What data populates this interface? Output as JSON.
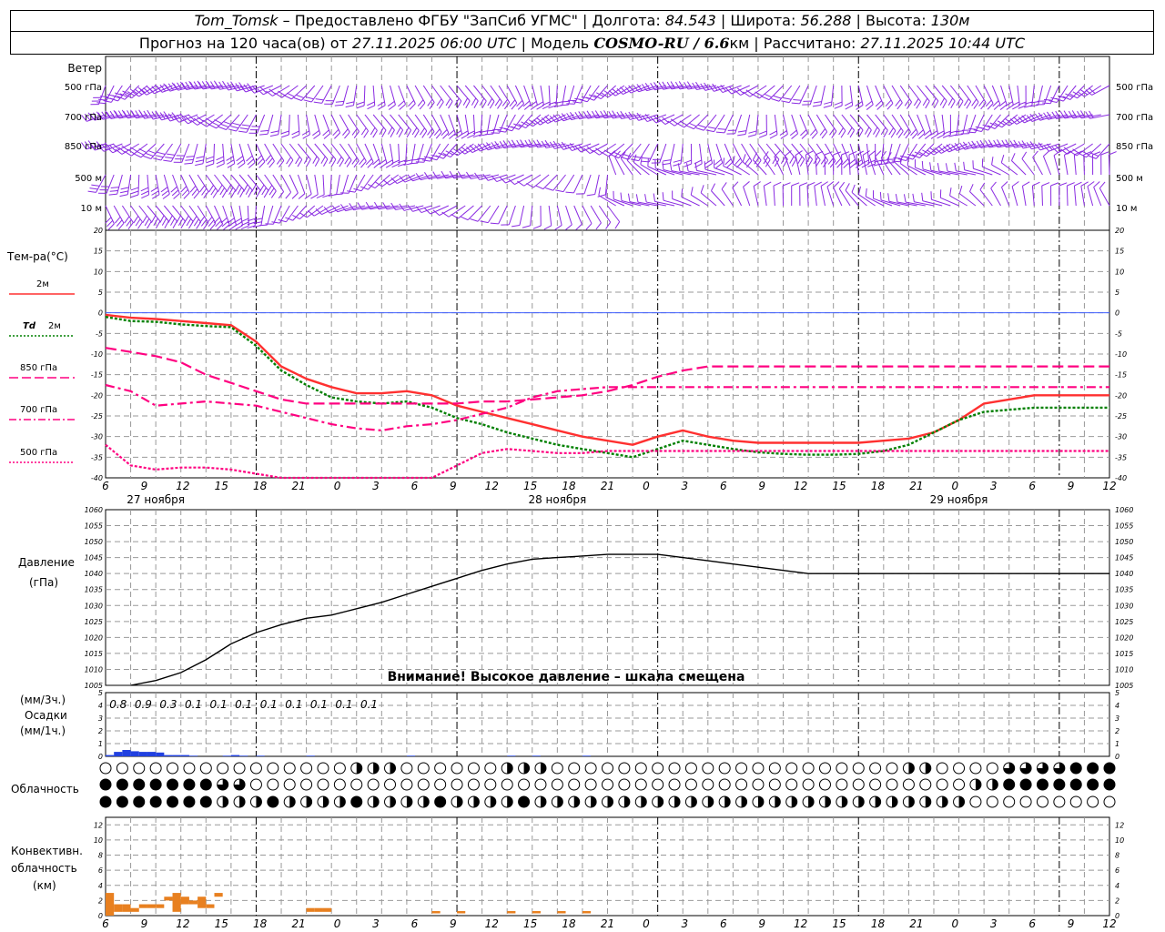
{
  "header": {
    "station": "Tom_Tomsk",
    "provider": " – Предоставлено ФГБУ \"ЗапСиб УГМС\" | Долгота: ",
    "lon": "84.543",
    "lat_label": " | Широта: ",
    "lat": "56.288",
    "alt_label": " | Высота: ",
    "alt": "130м",
    "forecast_label": "Прогноз на 120 часа(ов) от ",
    "forecast_start": "27.11.2025 06:00 UTC",
    "model_label": "  | Модель ",
    "model": "COSMO-RU / 6.6",
    "model_unit": "км",
    "calc_label": " | Рассчитано: ",
    "calc_time": "27.11.2025 10:44 UTC"
  },
  "labels": {
    "wind": "Ветер",
    "wind_levels": [
      "500 гПа",
      "700 гПа",
      "850 гПа",
      "500 м",
      "10 м"
    ],
    "temp": "Тем-ра(°С)",
    "t2m": "2м",
    "td_a": "Td",
    "td_b": "2м",
    "t850": "850 гПа",
    "t700": "700 гПа",
    "t500": "500 гПа",
    "pressure": "Давление",
    "pressure_unit": "(гПа)",
    "pressure_warning": "Внимание! Высокое давление – шкала смещена",
    "precip_3h": "(мм/3ч.)",
    "precip": "Осадки",
    "precip_1h": "(мм/1ч.)",
    "cloud": "Облачность",
    "conv1": "Конвективн.",
    "conv2": "облачность",
    "conv3": "(км)"
  },
  "colors": {
    "wind": "#8a2be2",
    "t2m": "#ff3030",
    "td": "#008000",
    "t850": "#ff0080",
    "t700": "#ff0080",
    "t500": "#ff0080",
    "pressure": "#000000",
    "precip": "#2040e0",
    "conv": "#e88020",
    "zero_line": "#4060ff"
  },
  "chart_data": [
    {
      "type": "line",
      "name": "temperature",
      "x_hours": [
        0,
        3,
        6,
        9,
        12,
        15,
        18,
        21,
        24,
        27,
        30,
        33,
        36,
        39,
        42,
        45,
        48,
        51,
        54,
        57,
        60,
        63,
        66,
        69,
        72,
        75,
        78,
        81,
        84,
        87,
        90,
        93,
        96,
        99,
        102,
        105,
        108,
        111,
        114,
        117,
        120
      ],
      "x_tick_labels": [
        "6",
        "9",
        "12",
        "15",
        "18",
        "21",
        "0",
        "3",
        "6",
        "9",
        "12",
        "15",
        "18",
        "21",
        "0",
        "3",
        "6",
        "9",
        "12",
        "15",
        "18",
        "21",
        "0",
        "3",
        "6",
        "9",
        "12"
      ],
      "day_labels": [
        "27 ноября",
        "28 ноября",
        "29 ноября"
      ],
      "ylim": [
        -40,
        20
      ],
      "y_ticks": [
        20,
        15,
        10,
        5,
        0,
        -5,
        -10,
        -15,
        -20,
        -25,
        -30,
        -35,
        -40
      ],
      "series": [
        {
          "name": "2м",
          "style": "solid",
          "values": [
            -0.5,
            -1.2,
            -1.5,
            -2,
            -2.5,
            -3,
            -7,
            -13,
            -16,
            -18,
            -19.5,
            -19.5,
            -19,
            -20,
            -22.5,
            -24,
            -25.5,
            -27,
            -28.5,
            -30,
            -31,
            -32,
            -30,
            -28.5,
            -30,
            -31,
            -31.5,
            -31.5,
            -31.5,
            -31.5,
            -31.5,
            -31,
            -30.5,
            -29,
            -26,
            -22,
            -21,
            -20,
            -20,
            -20,
            -20
          ]
        },
        {
          "name": "Td 2м",
          "style": "dotted",
          "values": [
            -1,
            -2,
            -2.2,
            -2.8,
            -3.2,
            -3.5,
            -8,
            -14,
            -17.5,
            -20.5,
            -21.5,
            -22,
            -21.5,
            -23,
            -25.5,
            -27,
            -29,
            -30.5,
            -32,
            -33,
            -34,
            -35,
            -33,
            -31,
            -32,
            -33,
            -33.8,
            -34.2,
            -34.4,
            -34.4,
            -34.2,
            -33.5,
            -32,
            -29,
            -26,
            -24,
            -23.5,
            -23,
            -23,
            -23,
            -23
          ]
        },
        {
          "name": "850 гПа",
          "style": "dash",
          "values": [
            -8.5,
            -9.5,
            -10.5,
            -12,
            -15,
            -17,
            -19,
            -21,
            -22,
            -22,
            -22,
            -22,
            -22,
            -22,
            -22,
            -21.5,
            -21.5,
            -21,
            -20.5,
            -20,
            -19,
            -17.5,
            -15.5,
            -14,
            -13,
            -13,
            -13,
            -13,
            -13,
            -13,
            -13,
            -13,
            -13,
            -13,
            -13,
            -13,
            -13,
            -13,
            -13,
            -13,
            -13
          ]
        },
        {
          "name": "700 гПа",
          "style": "dashdot",
          "values": [
            -17.5,
            -19,
            -22.5,
            -22,
            -21.5,
            -22,
            -22.5,
            -24,
            -25.5,
            -27,
            -28,
            -28.5,
            -27.5,
            -27,
            -26,
            -24.5,
            -23,
            -20.5,
            -19,
            -18.5,
            -18,
            -18,
            -18,
            -18,
            -18,
            -18,
            -18,
            -18,
            -18,
            -18,
            -18,
            -18,
            -18,
            -18,
            -18,
            -18,
            -18,
            -18,
            -18,
            -18,
            -18
          ]
        },
        {
          "name": "500 гПа",
          "style": "dotted",
          "values": [
            -32,
            -37,
            -38,
            -37.5,
            -37.5,
            -38,
            -39,
            -40,
            -42,
            -42,
            -42,
            -42,
            -41,
            -40,
            -37,
            -34,
            -33,
            -33.5,
            -34,
            -34,
            -33.5,
            -33.5,
            -33.5,
            -33.5,
            -33.5,
            -33.5,
            -33.5,
            -33.5,
            -33.5,
            -33.5,
            -33.5,
            -33.5,
            -33.5,
            -33.5,
            -33.5,
            -33.5,
            -33.5,
            -33.5,
            -33.5,
            -33.5,
            -33.5
          ]
        }
      ]
    },
    {
      "type": "line",
      "name": "pressure",
      "ylim": [
        1005,
        1060
      ],
      "y_ticks": [
        1060,
        1055,
        1050,
        1045,
        1040,
        1035,
        1030,
        1025,
        1020,
        1015,
        1010,
        1005
      ],
      "series": [
        {
          "name": "pressure",
          "values": [
            1004.5,
            1005,
            1006.5,
            1009,
            1013,
            1018,
            1021.5,
            1024,
            1026,
            1027,
            1029,
            1031,
            1033.5,
            1036,
            1038.5,
            1041,
            1043,
            1044.5,
            1045,
            1045.5,
            1046,
            1046,
            1046,
            1045,
            1044,
            1043,
            1042,
            1041,
            1040,
            1040,
            1040,
            1040,
            1040,
            1040,
            1040,
            1040,
            1040,
            1040,
            1040,
            1040,
            1040
          ]
        }
      ]
    },
    {
      "type": "bar",
      "name": "precipitation",
      "ylim": [
        0,
        5
      ],
      "y_ticks": [
        5,
        4,
        3,
        2,
        1,
        0
      ],
      "totals_3h": [
        "0.8",
        "0.9",
        "0.3",
        "0.1",
        "0.1",
        "0.1",
        "0.1",
        "0.1",
        "0.1",
        "0.1",
        "0.1"
      ],
      "hourly": [
        {
          "h": 0,
          "v": 0.1
        },
        {
          "h": 1,
          "v": 0.35
        },
        {
          "h": 2,
          "v": 0.5
        },
        {
          "h": 3,
          "v": 0.4
        },
        {
          "h": 4,
          "v": 0.35
        },
        {
          "h": 5,
          "v": 0.35
        },
        {
          "h": 6,
          "v": 0.3
        },
        {
          "h": 7,
          "v": 0.1
        },
        {
          "h": 8,
          "v": 0.1
        },
        {
          "h": 9,
          "v": 0.1
        },
        {
          "h": 10,
          "v": 0.05
        },
        {
          "h": 14,
          "v": 0.05
        },
        {
          "h": 15,
          "v": 0.1
        },
        {
          "h": 16,
          "v": 0.05
        },
        {
          "h": 18,
          "v": 0.05
        },
        {
          "h": 24,
          "v": 0.05
        },
        {
          "h": 36,
          "v": 0.05
        },
        {
          "h": 48,
          "v": 0.05
        },
        {
          "h": 51,
          "v": 0.05
        },
        {
          "h": 57,
          "v": 0.05
        }
      ]
    },
    {
      "type": "bar",
      "name": "convective_cloud",
      "ylim": [
        0,
        13
      ],
      "y_ticks": [
        12,
        10,
        8,
        6,
        4,
        2,
        0
      ],
      "segments": [
        {
          "h": 0,
          "base": 0,
          "top": 3
        },
        {
          "h": 1,
          "base": 0.5,
          "top": 1.5
        },
        {
          "h": 2,
          "base": 0.5,
          "top": 1.5
        },
        {
          "h": 3,
          "base": 0.5,
          "top": 1
        },
        {
          "h": 4,
          "base": 1,
          "top": 1.5
        },
        {
          "h": 5,
          "base": 1,
          "top": 1.5
        },
        {
          "h": 6,
          "base": 1,
          "top": 1.5
        },
        {
          "h": 7,
          "base": 2,
          "top": 2.5
        },
        {
          "h": 8,
          "base": 0.5,
          "top": 3
        },
        {
          "h": 9,
          "base": 1.5,
          "top": 2.5
        },
        {
          "h": 10,
          "base": 1.5,
          "top": 2
        },
        {
          "h": 11,
          "base": 1,
          "top": 2.5
        },
        {
          "h": 12,
          "base": 1,
          "top": 1.5
        },
        {
          "h": 13,
          "base": 2.5,
          "top": 3
        },
        {
          "h": 24,
          "base": 0.5,
          "top": 1
        },
        {
          "h": 25,
          "base": 0.5,
          "top": 1
        },
        {
          "h": 26,
          "base": 0.5,
          "top": 1
        },
        {
          "h": 39,
          "base": 0.3,
          "top": 0.6
        },
        {
          "h": 42,
          "base": 0.3,
          "top": 0.6
        },
        {
          "h": 48,
          "base": 0.3,
          "top": 0.6
        },
        {
          "h": 51,
          "base": 0.3,
          "top": 0.6
        },
        {
          "h": 54,
          "base": 0.3,
          "top": 0.6
        },
        {
          "h": 57,
          "base": 0.3,
          "top": 0.6
        }
      ]
    }
  ]
}
